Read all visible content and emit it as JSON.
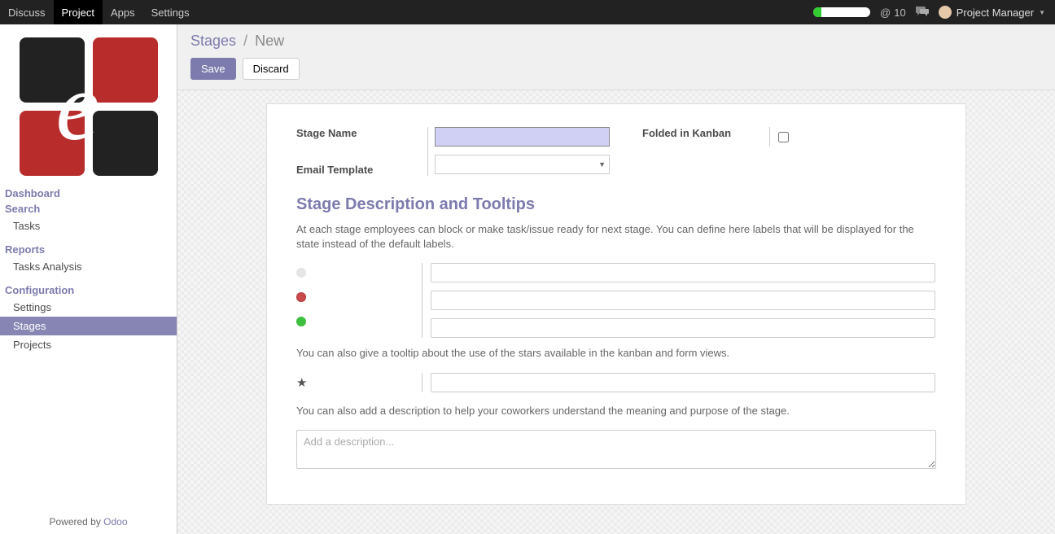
{
  "topnav": {
    "items": [
      "Discuss",
      "Project",
      "Apps",
      "Settings"
    ],
    "active_index": 1
  },
  "topbar": {
    "mentions_count": "10",
    "user_name": "Project Manager"
  },
  "sidebar": {
    "dashboard": "Dashboard",
    "search": "Search",
    "tasks": "Tasks",
    "reports": "Reports",
    "tasks_analysis": "Tasks Analysis",
    "configuration": "Configuration",
    "settings": "Settings",
    "stages": "Stages",
    "projects": "Projects",
    "powered_prefix": "Powered by ",
    "powered_link": "Odoo"
  },
  "breadcrumb": {
    "parent": "Stages",
    "current": "New"
  },
  "buttons": {
    "save": "Save",
    "discard": "Discard"
  },
  "form": {
    "stage_name_label": "Stage Name",
    "stage_name_value": "",
    "email_template_label": "Email Template",
    "folded_label": "Folded in Kanban",
    "folded_checked": false
  },
  "tooltips": {
    "title": "Stage Description and Tooltips",
    "desc1": "At each stage employees can block or make task/issue ready for next stage. You can define here labels that will be displayed for the state instead of the default labels.",
    "desc_star": "You can also give a tooltip about the use of the stars available in the kanban and form views.",
    "desc_descr": "You can also add a description to help your coworkers understand the meaning and purpose of the stage.",
    "description_placeholder": "Add a description...",
    "entries": {
      "grey_value": "",
      "red_value": "",
      "green_value": "",
      "star_value": "",
      "description_value": ""
    }
  }
}
